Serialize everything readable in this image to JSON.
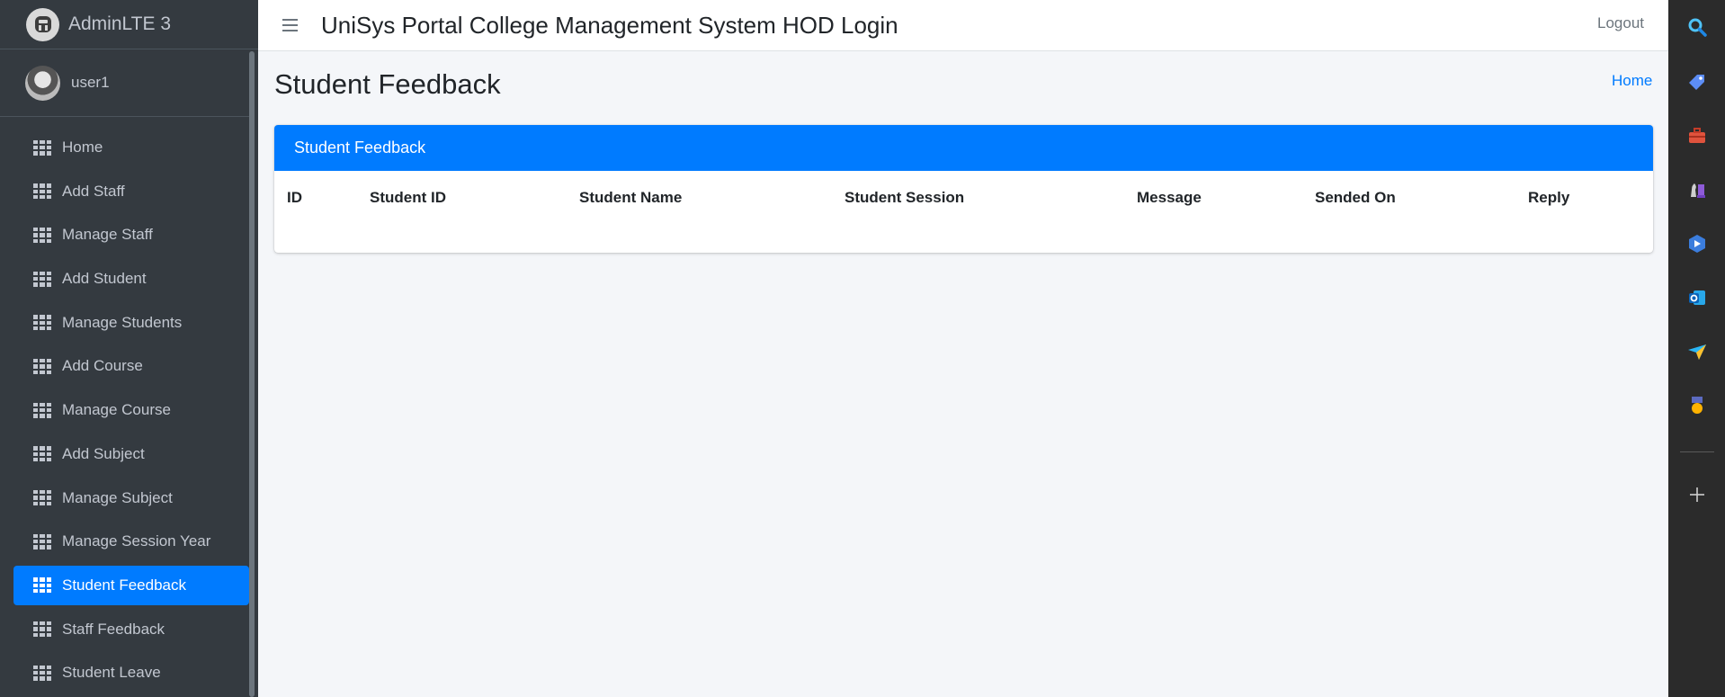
{
  "brand": {
    "name": "AdminLTE 3"
  },
  "user": {
    "name": "user1"
  },
  "nav": [
    {
      "label": "Home"
    },
    {
      "label": "Add Staff"
    },
    {
      "label": "Manage Staff"
    },
    {
      "label": "Add Student"
    },
    {
      "label": "Manage Students"
    },
    {
      "label": "Add Course"
    },
    {
      "label": "Manage Course"
    },
    {
      "label": "Add Subject"
    },
    {
      "label": "Manage Subject"
    },
    {
      "label": "Manage Session Year"
    },
    {
      "label": "Student Feedback",
      "active": true
    },
    {
      "label": "Staff Feedback"
    },
    {
      "label": "Student Leave"
    }
  ],
  "topbar": {
    "title": "UniSys Portal College Management System HOD Login",
    "logout": "Logout"
  },
  "page": {
    "title": "Student Feedback",
    "breadcrumb": "Home"
  },
  "card": {
    "header": "Student Feedback",
    "columns": [
      "ID",
      "Student ID",
      "Student Name",
      "Student Session",
      "Message",
      "Sended On",
      "Reply"
    ]
  },
  "colors": {
    "accent": "#007bff",
    "sidebar_bg": "#343a40",
    "content_bg": "#f4f6f9",
    "rail_bg": "#2b2b2b"
  },
  "rail_icons": [
    "search-icon",
    "tag-icon",
    "briefcase-icon",
    "chess-icon",
    "copilot-icon",
    "outlook-icon",
    "send-icon",
    "medal-icon",
    "add-icon"
  ]
}
